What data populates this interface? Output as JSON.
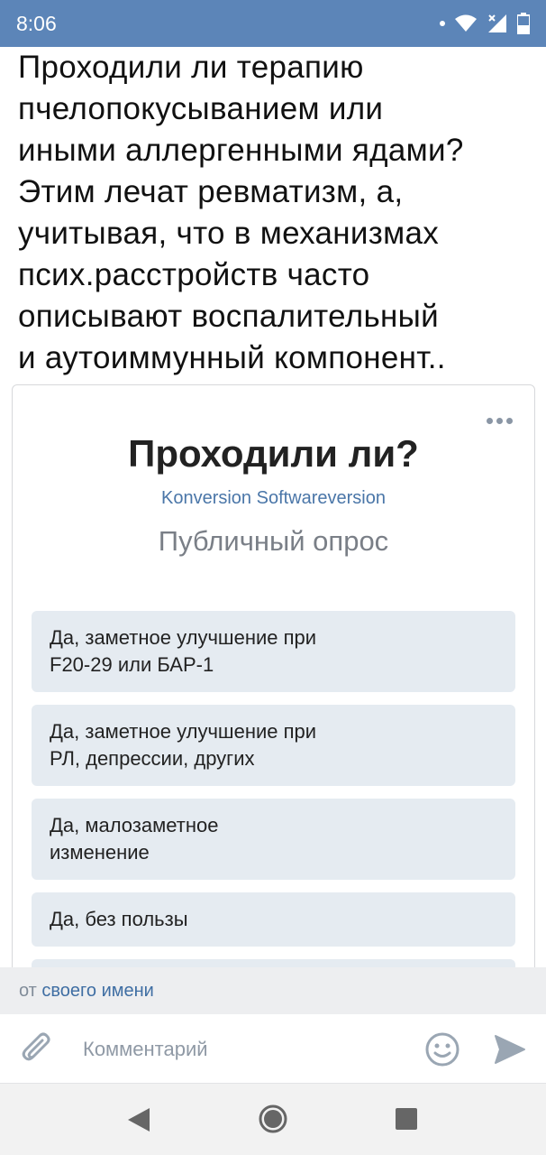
{
  "status_bar": {
    "time": "8:06"
  },
  "post": {
    "text": "Проходили ли терапию\nпчелопокусыванием или\nиными аллергенными ядами?\nЭтим лечат ревматизм, а,\nучитывая, что в механизмах\nпсих.расстройств часто\nописывают воспалительный\nи аутоиммунный компонент.."
  },
  "poll": {
    "title": "Проходили ли?",
    "author": "Konversion Softwareversion",
    "type": "Публичный опрос",
    "options": [
      {
        "label": "Да, заметное улучшение при\nF20-29 или БАР-1"
      },
      {
        "label": "Да, заметное улучшение при\nРЛ, депрессии, других"
      },
      {
        "label": "Да, малозаметное\nизменение"
      },
      {
        "label": "Да, без пользы"
      },
      {
        "label": ""
      }
    ]
  },
  "from_bar": {
    "prefix": "от",
    "link": "своего имени"
  },
  "comment": {
    "placeholder": "Комментарий"
  },
  "icons": {
    "attach": "paperclip-icon",
    "emoji": "smiley-icon",
    "send": "send-icon",
    "more": "more-dots-icon",
    "wifi": "wifi-icon",
    "signal": "signal-icon",
    "battery": "battery-icon"
  },
  "colors": {
    "status_bar": "#5c85b8",
    "link": "#4a76a8",
    "option_bg": "#e5ebf1",
    "icon_gray": "#9aa6b3"
  }
}
